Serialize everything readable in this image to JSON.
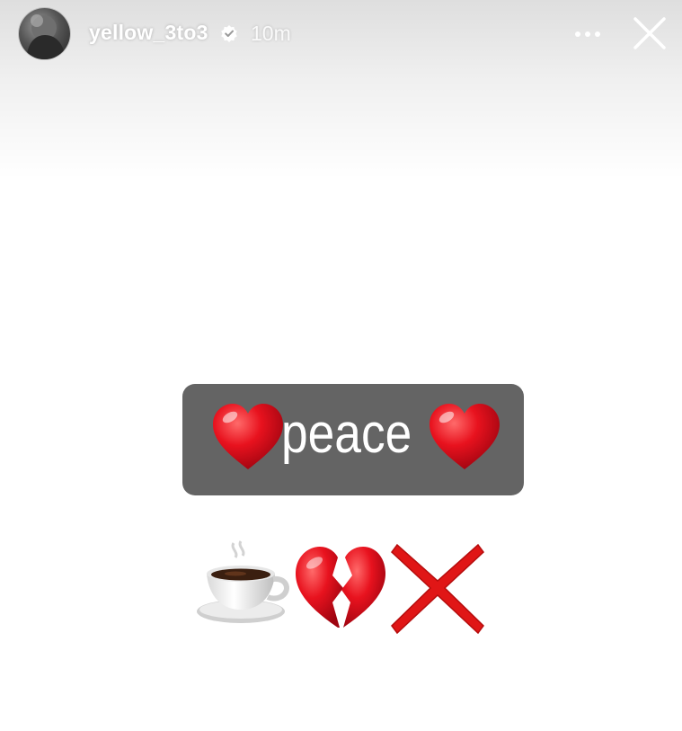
{
  "header": {
    "username": "yellow_3to3",
    "time_ago": "10m",
    "verified_icon": "verified-badge-icon",
    "more_icon": "more-options-icon",
    "close_icon": "close-icon"
  },
  "story": {
    "sticker_text": "peace",
    "sticker_icons": [
      "red-heart-icon",
      "red-heart-icon"
    ],
    "emoji_row": [
      "coffee-cup-icon",
      "broken-heart-icon",
      "red-cross-icon"
    ]
  },
  "colors": {
    "sticker_bg": "#646464",
    "heart_red": "#e0121f",
    "cross_red": "#e01616"
  }
}
